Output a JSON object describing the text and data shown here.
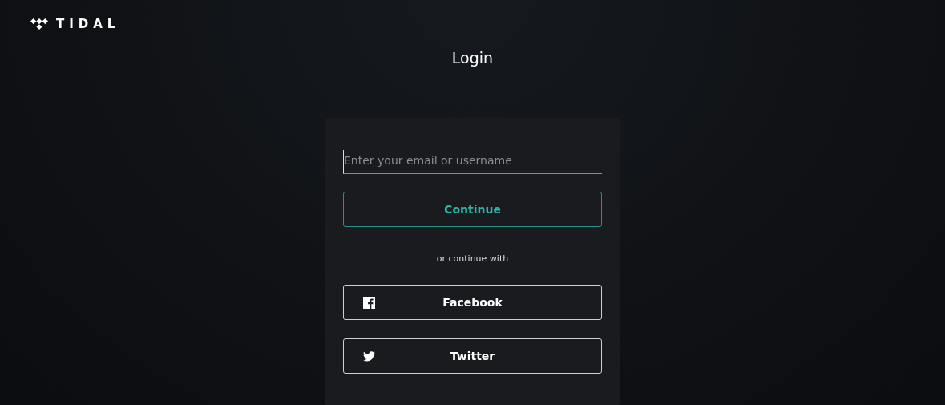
{
  "brand": {
    "name": "TIDAL"
  },
  "page_title": "Login",
  "login_form": {
    "email_field": {
      "placeholder": "Enter your email or username",
      "focused": true
    },
    "continue_button": "Continue",
    "divider_text": "or continue with",
    "social_buttons": [
      {
        "kind": "facebook",
        "label": "Facebook"
      },
      {
        "kind": "twitter",
        "label": "Twitter"
      }
    ]
  }
}
